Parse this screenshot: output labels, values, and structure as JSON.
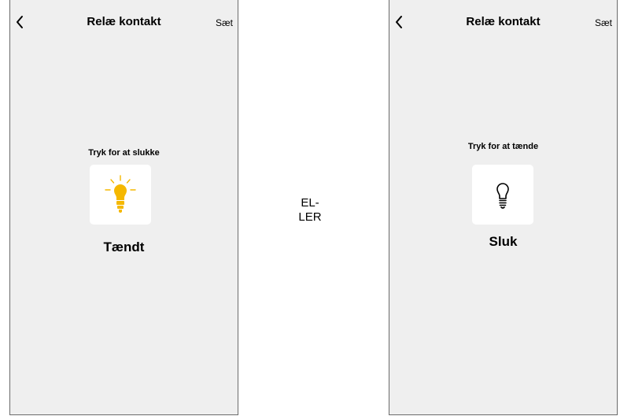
{
  "left_screen": {
    "title": "Relæ kontakt",
    "action": "Sæt",
    "hint": "Tryk for at slukke",
    "state": "Tændt",
    "bulb_icon": "lightbulb-on-icon",
    "bulb_color": "#f5b800"
  },
  "separator": {
    "line1": "EL-",
    "line2": "LER"
  },
  "right_screen": {
    "title": "Relæ kontakt",
    "action": "Sæt",
    "hint": "Tryk for at tænde",
    "state": "Sluk",
    "bulb_icon": "lightbulb-off-icon",
    "bulb_color": "#000000"
  }
}
